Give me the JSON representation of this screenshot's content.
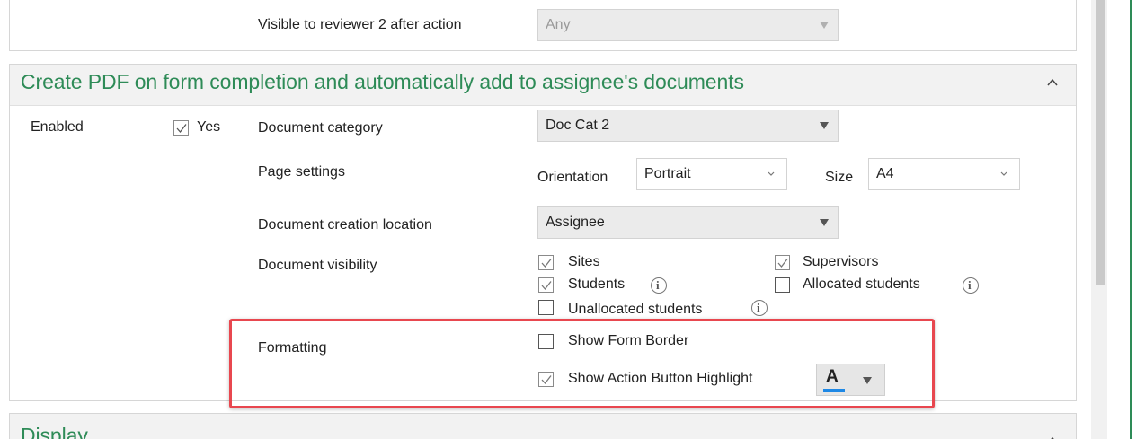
{
  "top_section": {
    "label": "Visible to reviewer 2 after action",
    "dropdown_value": "Any"
  },
  "pdf_section": {
    "title": "Create PDF on form completion and automatically add to assignee's documents",
    "enabled_label": "Enabled",
    "enabled_checkbox_label": "Yes",
    "enabled_checked": true,
    "document_category_label": "Document category",
    "document_category_value": "Doc Cat 2",
    "page_settings_label": "Page settings",
    "orientation_label": "Orientation",
    "orientation_value": "Portrait",
    "size_label": "Size",
    "size_value": "A4",
    "document_creation_location_label": "Document creation location",
    "document_creation_location_value": "Assignee",
    "document_visibility_label": "Document visibility",
    "visibility_options": [
      {
        "label": "Sites",
        "checked": true
      },
      {
        "label": "Supervisors",
        "checked": true
      },
      {
        "label": "Students",
        "checked": true
      },
      {
        "label": "Allocated students",
        "checked": false
      },
      {
        "label": "Unallocated students",
        "checked": false
      }
    ],
    "formatting_label": "Formatting",
    "show_form_border_label": "Show Form Border",
    "show_form_border_checked": false,
    "show_action_button_highlight_label": "Show Action Button Highlight",
    "show_action_button_highlight_checked": true,
    "highlight_color_letter": "A",
    "highlight_color": "#1e88e5"
  },
  "display_section": {
    "title": "Display"
  },
  "colors": {
    "accent": "#2e8b57",
    "highlight_box": "#e8474f"
  }
}
